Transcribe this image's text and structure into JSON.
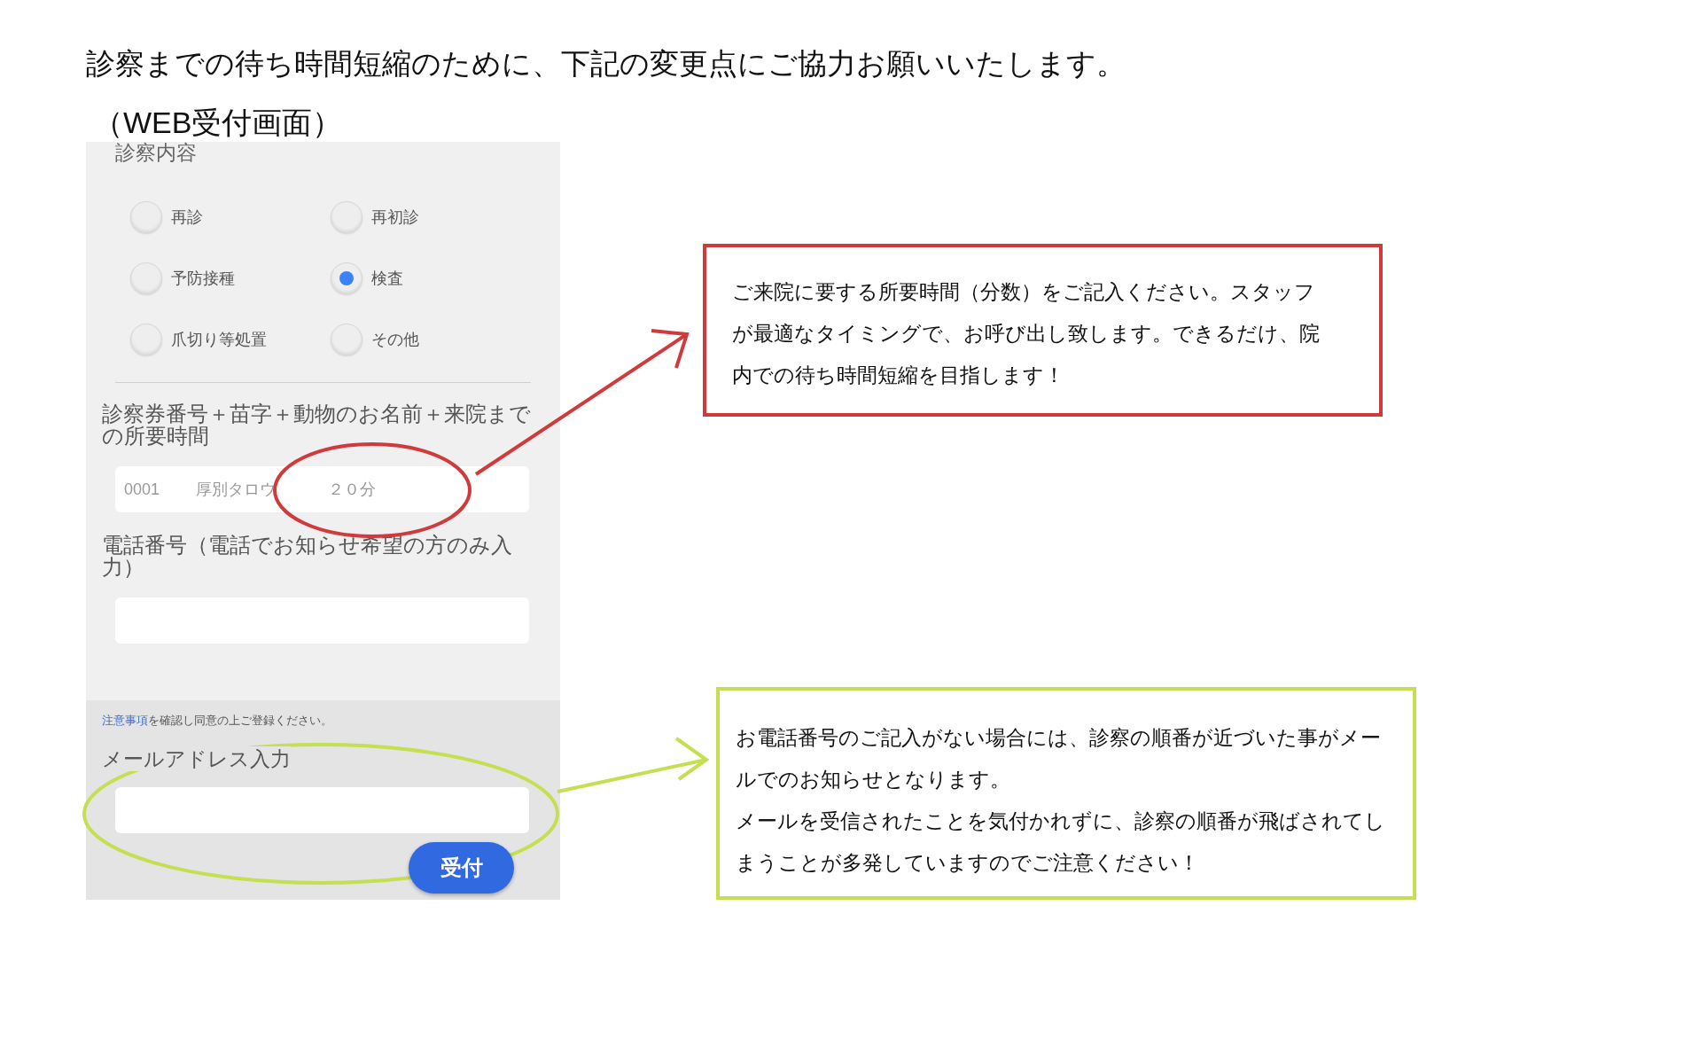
{
  "heading": "診察までの待ち時間短縮のために、下記の変更点にご協力お願いいたします。",
  "caption": "（WEB受付画面）",
  "form": {
    "section_title": "診察内容",
    "options": [
      {
        "label": "再診",
        "selected": false
      },
      {
        "label": "再初診",
        "selected": false
      },
      {
        "label": "予防接種",
        "selected": false
      },
      {
        "label": "検査",
        "selected": true
      },
      {
        "label": "爪切り等処置",
        "selected": false
      },
      {
        "label": "その他",
        "selected": false
      }
    ],
    "fields": [
      {
        "label": "診察券番号＋苗字＋動物のお名前＋来院までの所要時間",
        "value": "0001　　 厚別タロウ　　　 ２０分"
      },
      {
        "label": "電話番号（電話でお知らせ希望の方のみ入力）"
      }
    ],
    "notice": {
      "link": "注意事項",
      "text": "を確認し同意の上ご登録ください。"
    },
    "email": {
      "label": "メールアドレス入力"
    },
    "submit": "受付"
  },
  "notes": [
    {
      "color": "#d03a3a",
      "paragraphs": [
        "ご来院に要する所要時間（分数）をご記入ください。スタッフが最適なタイミングで、お呼び出し致します。できるだけ、院内での待ち時間短縮を目指します！"
      ]
    },
    {
      "color": "#c4df52",
      "paragraphs": [
        "お電話番号のご記入がない場合には、診察の順番が近づいた事がメールでのお知らせとなります。",
        "メールを受信されたことを気付かれずに、診察の順番が飛ばされてしまうことが多発していますのでご注意ください！"
      ]
    }
  ]
}
